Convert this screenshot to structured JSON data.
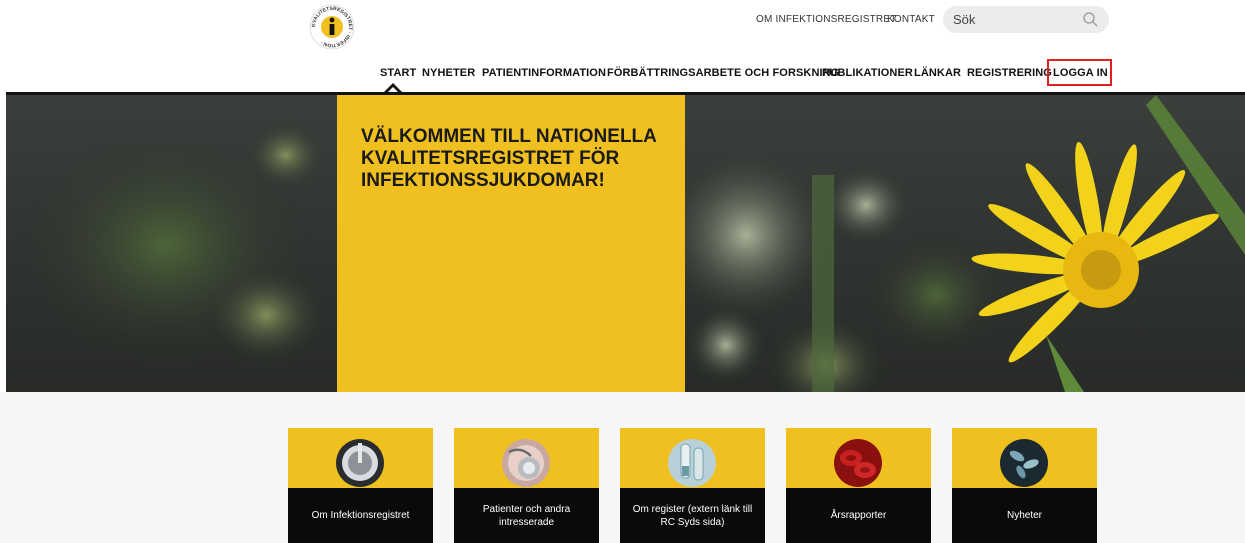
{
  "header": {
    "logo_ring_text": "KVALITETSREGISTRET · INFEKTION ·",
    "logo_letter": "i",
    "top_links": [
      "OM INFEKTIONSREGISTRET",
      "KONTAKT"
    ],
    "search": {
      "placeholder": "Sök"
    }
  },
  "nav": {
    "items": [
      {
        "label": "START"
      },
      {
        "label": "NYHETER"
      },
      {
        "label": "PATIENTINFORMATION"
      },
      {
        "label": "FÖRBÄTTRINGSARBETE OCH FORSKNING"
      },
      {
        "label": "PUBLIKATIONER"
      },
      {
        "label": "LÄNKAR"
      },
      {
        "label": "REGISTRERING"
      },
      {
        "label": "LOGGA IN"
      }
    ],
    "active": "START",
    "highlight_color": "#e02020"
  },
  "hero": {
    "title": "VÄLKOMMEN TILL NATIONELLA KVALITETSREGISTRET FÖR INFEKTIONSSJUKDOMAR!",
    "box_color": "#f0c020"
  },
  "cards": [
    {
      "label": "Om Infektionsregistret",
      "icon": "dial-icon"
    },
    {
      "label": "Patienter och andra intresserade",
      "icon": "stethoscope-icon"
    },
    {
      "label": "Om register (extern länk till RC Syds sida)",
      "icon": "test-tube-icon"
    },
    {
      "label": "Årsrapporter",
      "icon": "blood-cells-icon"
    },
    {
      "label": "Nyheter",
      "icon": "bacteria-icon"
    }
  ]
}
